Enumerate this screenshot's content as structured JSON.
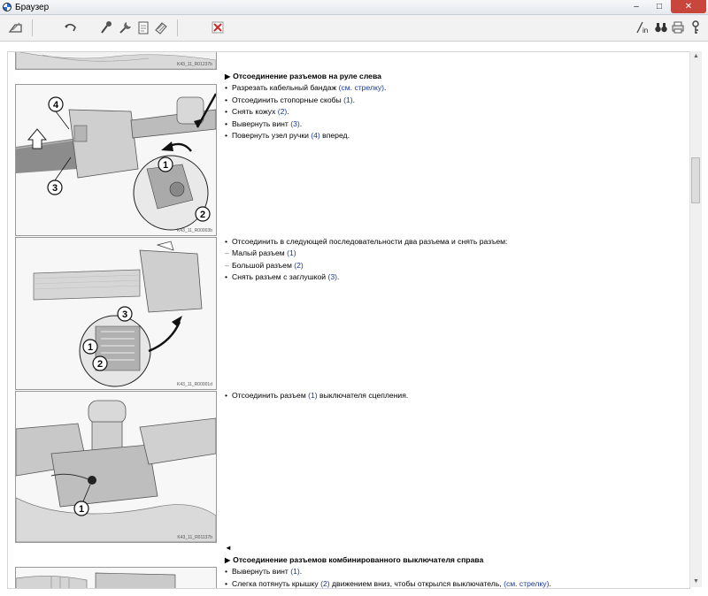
{
  "window": {
    "title": "Браузер",
    "buttons": {
      "minimize": "–",
      "maximize": "□",
      "close": "✕"
    }
  },
  "toolbar": {
    "icons": [
      "tag-edit-icon",
      "hook-back-icon",
      "lamp-tool-icon",
      "wrench-tool-icon",
      "document-clip-icon",
      "stack-docs-icon",
      "close-red-icon",
      "info-index-icon",
      "binoculars-icon",
      "printer-icon",
      "help-key-icon"
    ],
    "accent": "#cc2b2b"
  },
  "figures": [
    {
      "caption": "K43_11_R01237b"
    },
    {
      "caption": "K43_11_R00003b",
      "callouts": [
        "4",
        "3",
        "1",
        "2"
      ]
    },
    {
      "caption": "K43_11_R00001d",
      "callouts": [
        "3",
        "1",
        "2"
      ]
    },
    {
      "caption": "K43_11_R01137b",
      "callouts": [
        "1"
      ]
    },
    {
      "caption": ""
    }
  ],
  "sections": {
    "s1": {
      "heading": "Отсоединение разъемов на руле слева",
      "steps": [
        {
          "text": "Разрезать кабельный бандаж ",
          "link": "(см. стрелку)",
          "tail": "."
        },
        {
          "text": "Отсоединить стопорные скобы ",
          "link": "(1)",
          "tail": "."
        },
        {
          "text": "Снять кожух ",
          "link": "(2)",
          "tail": "."
        },
        {
          "text": "Вывернуть винт ",
          "link": "(3)",
          "tail": "."
        },
        {
          "text": "Повернуть узел ручки ",
          "link": "(4)",
          "tail": " вперед."
        }
      ]
    },
    "s2": {
      "intro": "Отсоединить в следующей последовательности два разъема и снять разъем:",
      "subs": [
        {
          "text": "Малый разъем ",
          "link": "(1)"
        },
        {
          "text": "Большой разъем ",
          "link": "(2)"
        }
      ],
      "last": {
        "text": "Снять разъем с заглушкой ",
        "link": "(3)",
        "tail": "."
      }
    },
    "s3": {
      "step": {
        "text": "Отсоединить разъем ",
        "link": "(1)",
        "tail": " выключателя сцепления."
      }
    },
    "back_marker": "◄",
    "s4": {
      "heading": "Отсоединение разъемов комбинированного выключателя справа",
      "steps": [
        {
          "text": "Вывернуть винт ",
          "link": "(1)",
          "tail": "."
        },
        {
          "text": "Слегка потянуть крышку ",
          "link": "(2)",
          "tail": " движением вниз, чтобы открылся выключатель, ",
          "link2": "(см. стрелку)",
          "tail2": "."
        }
      ]
    }
  },
  "scrollbar": {
    "up": "▲",
    "down": "▼"
  }
}
